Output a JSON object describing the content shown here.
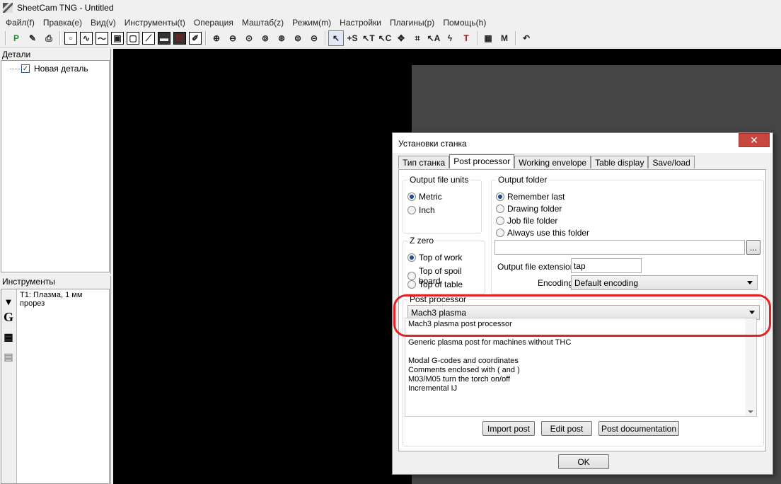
{
  "window": {
    "title": "SheetCam TNG - Untitled"
  },
  "menu": [
    "Файл(f)",
    "Правка(e)",
    "Вид(v)",
    "Инструменты(t)",
    "Операция",
    "Маштаб(z)",
    "Режим(m)",
    "Настройки",
    "Плагины(p)",
    "Помощь(h)"
  ],
  "toolbar": {
    "icons": [
      "post-icon",
      "edit-icon",
      "print-icon",
      "view-icons",
      "zoom-icons",
      "select-tool-icons",
      "calculator-icon",
      "macro-icon",
      "undo-icon"
    ]
  },
  "details": {
    "header": "Детали",
    "item": "Новая деталь",
    "item_checked": true
  },
  "tools": {
    "header": "Инструменты",
    "item": "T1: Плазма, 1 мм прорез"
  },
  "dialog": {
    "title": "Установки станка",
    "close_glyph": "✕",
    "tabs": [
      "Тип станка",
      "Post processor",
      "Working envelope",
      "Table display",
      "Save/load"
    ],
    "active_tab": "Post processor",
    "output_units": {
      "title": "Output file units",
      "options": [
        "Metric",
        "Inch"
      ],
      "selected": "Metric"
    },
    "z_zero": {
      "title": "Z zero",
      "options": [
        "Top of work",
        "Top of spoil board",
        "Top of table"
      ],
      "selected": "Top of work"
    },
    "output_folder": {
      "title": "Output folder",
      "options": [
        "Remember last",
        "Drawing folder",
        "Job file folder",
        "Always use this folder"
      ],
      "selected": "Remember last",
      "path_value": "",
      "browse_label": "..."
    },
    "extension": {
      "label": "Output file extension",
      "value": "tap"
    },
    "encoding": {
      "label": "Encoding",
      "value": "Default encoding"
    },
    "post_processor": {
      "title": "Post processor",
      "value": "Mach3 plasma",
      "description": [
        "Mach3 plasma post processor",
        "",
        "Generic plasma post for machines without THC",
        "",
        "Modal G-codes and coordinates",
        "Comments enclosed with ( and )",
        "M03/M05 turn the torch on/off",
        "Incremental IJ"
      ]
    },
    "buttons": {
      "import": "Import post",
      "edit": "Edit post",
      "docs": "Post documentation",
      "ok": "OK"
    }
  },
  "colors": {
    "highlight": "#e32323",
    "canvas": "#000000",
    "sheet": "#454545",
    "close": "#c7463d"
  }
}
